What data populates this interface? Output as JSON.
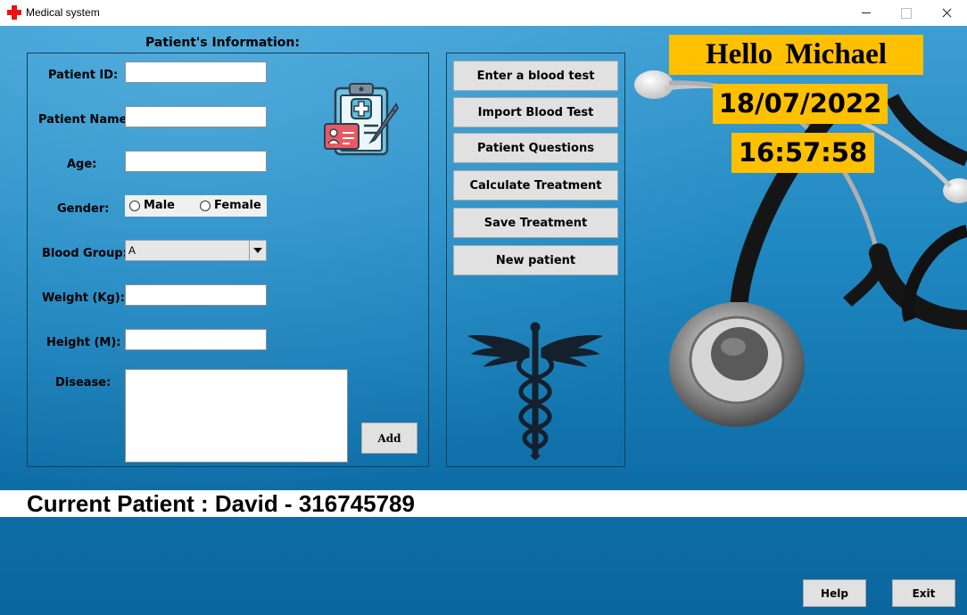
{
  "window": {
    "title": "Medical system",
    "icon": "red-cross-icon"
  },
  "form": {
    "section_title": "Patient's Information:",
    "patient_id_label": "Patient ID:",
    "patient_id_value": "",
    "patient_name_label": "Patient Name:",
    "patient_name_value": "",
    "age_label": "Age:",
    "age_value": "",
    "gender_label": "Gender:",
    "gender_male": "Male",
    "gender_female": "Female",
    "blood_group_label": "Blood Group:",
    "blood_group_value": "A",
    "weight_label": "Weight (Kg):",
    "weight_value": "",
    "height_label": "Height (M):",
    "height_value": "",
    "disease_label": "Disease:",
    "disease_value": "",
    "add_label": "Add"
  },
  "actions": [
    {
      "label": "Enter a blood test"
    },
    {
      "label": "Import Blood Test"
    },
    {
      "label": "Patient Questions"
    },
    {
      "label": "Calculate Treatment"
    },
    {
      "label": "Save Treatment"
    },
    {
      "label": "New patient"
    }
  ],
  "header": {
    "greeting": "Hello  Michael",
    "date": "18/07/2022",
    "time": "16:57:58"
  },
  "status": {
    "current_patient": "Current Patient : David - 316745789"
  },
  "footer": {
    "help_label": "Help",
    "exit_label": "Exit"
  },
  "colors": {
    "accent": "#ffc000",
    "background": "#1e78ad",
    "button": "#e1e1e1"
  },
  "icons": [
    "clipboard-icon",
    "caduceus-icon",
    "stethoscope-image"
  ]
}
